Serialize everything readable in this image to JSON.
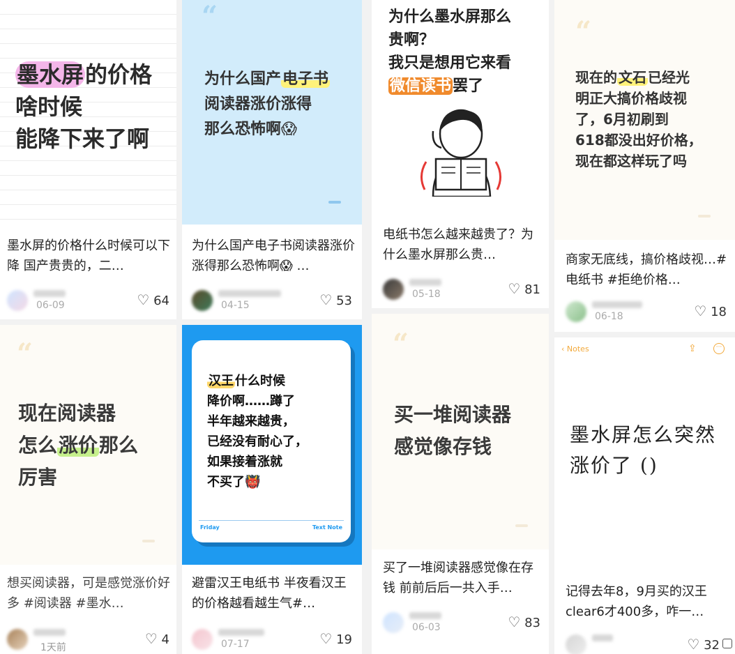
{
  "cards": [
    {
      "cover_lines": [
        "墨水屏的价格",
        "啥时候",
        "能降下来了啊"
      ],
      "cover_highlight": "墨水屏",
      "caption": "墨水屏的价格什么时候可以下降 国产贵贵的，二…",
      "date": "06-09",
      "likes": "64"
    },
    {
      "cover_quote": "“",
      "cover_lines": [
        "为什么国产电子书",
        "阅读器涨价涨得",
        "那么恐怖啊😱"
      ],
      "cover_highlight": "电子书",
      "caption": "为什么国产电子书阅读器涨价涨得那么恐怖啊😱 …",
      "date": "04-15",
      "likes": "53"
    },
    {
      "cover_lines": [
        "为什么墨水屏那么",
        "贵啊？",
        "我只是想用它来看",
        "微信读书罢了"
      ],
      "cover_highlight": "微信读书",
      "caption": "电纸书怎么越来越贵了？为什么墨水屏那么贵…",
      "date": "05-18",
      "likes": "81"
    },
    {
      "cover_quote": "“",
      "cover_lines": [
        "现在的文石已经光",
        "明正大搞价格歧视",
        "了，6月初刷到",
        "618都没出好价格，",
        "现在都这样玩了吗"
      ],
      "cover_highlight": "文石",
      "caption": "商家无底线，搞价格歧视…#电纸书 #拒绝价格…",
      "date": "06-18",
      "likes": "18"
    },
    {
      "cover_quote": "“",
      "cover_lines": [
        "现在阅读器",
        "怎么涨价那么",
        "厉害"
      ],
      "cover_highlight": "涨价",
      "caption": "想买阅读器，可是感觉涨价好多 #阅读器 #墨水…",
      "date": "1天前",
      "likes": "4"
    },
    {
      "cover_lines": [
        "汉王什么时候",
        "降价啊……蹲了",
        "半年越来越贵，",
        "已经没有耐心了，",
        "如果接着涨就",
        "不买了👹"
      ],
      "cover_highlight": "汉王",
      "note_left": "Friday",
      "note_right": "Text Note",
      "caption": "避雷汉王电纸书 半夜看汉王的价格越看越生气#…",
      "date": "07-17",
      "likes": "19"
    },
    {
      "cover_quote": "“",
      "cover_lines": [
        "买一堆阅读器",
        "感觉像存钱"
      ],
      "caption": "买了一堆阅读器感觉像在存钱 前前后后一共入手…",
      "date": "06-03",
      "likes": "83"
    },
    {
      "notes_back": "Notes",
      "cover_lines": [
        "墨水屏怎么突然",
        "涨价了 ()"
      ],
      "caption": "记得去年8，9月买的汉王clear6才400多，咋一…",
      "likes": "32"
    }
  ],
  "colors": {
    "accent_pink": "#f4b6e9",
    "accent_yellow": "#fff27a",
    "accent_orange": "#f08a2c",
    "accent_green": "#c6f08c",
    "blue_cover": "#d2ecfb",
    "blue_frame": "#1e9af0",
    "notes_orange": "#f2a93b"
  }
}
